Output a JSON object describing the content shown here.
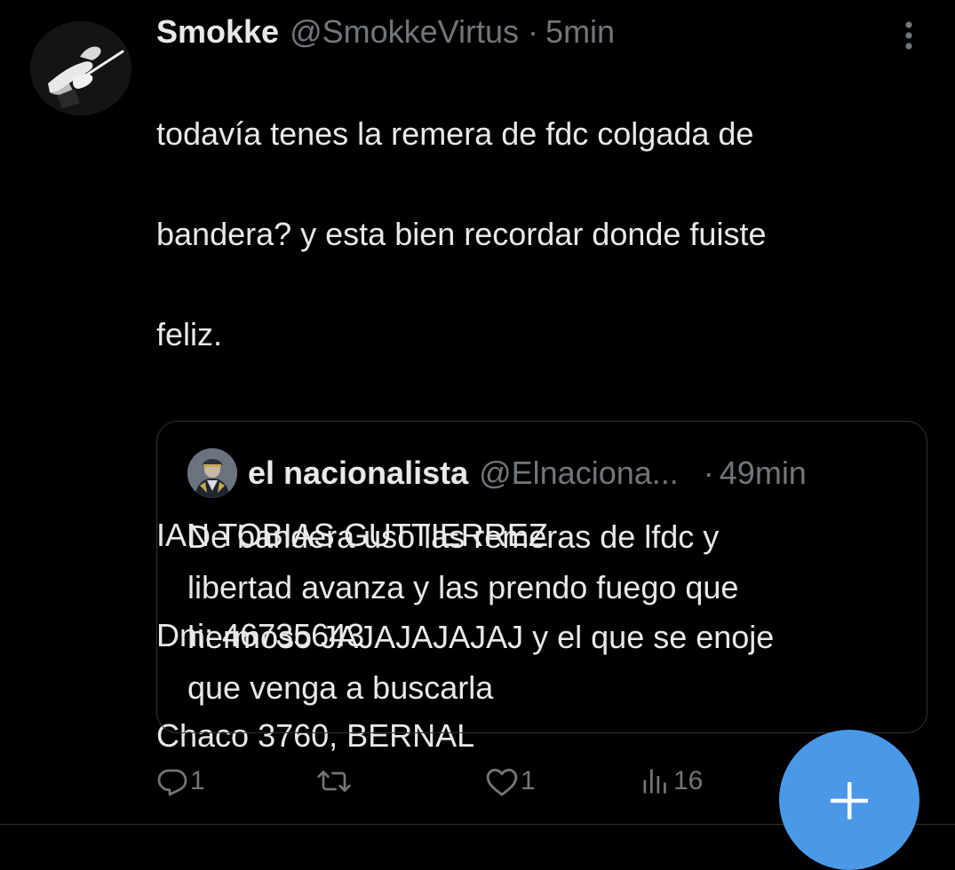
{
  "tweet": {
    "display_name": "Smokke",
    "handle": "@SmokkeVirtus",
    "separator": "·",
    "time": "5min",
    "avatar_icon": "conductor-hands-avatar",
    "text_lines": [
      "todavía tenes la remera de fdc colgada de",
      "bandera? y esta bien recordar donde fuiste",
      "feliz.",
      "",
      "IAN TOBIAS GUTTIERREZ",
      "Dni: 46735643",
      "Chaco 3760, BERNAL"
    ]
  },
  "quoted_tweet": {
    "display_name": "el nacionalista",
    "handle": "@Elnaciona...",
    "separator": "·",
    "time": "49min",
    "avatar_icon": "uniformed-man-avatar",
    "text_lines": [
      "De bandera uso las remeras de lfdc y",
      "libertad avanza y las prendo fuego que",
      "hermoso JAJAJAJAJAJ y el que se enoje",
      "que venga a buscarla"
    ]
  },
  "actions": {
    "reply_count": "1",
    "retweet_count": "",
    "like_count": "1",
    "views_count": "16"
  },
  "colors": {
    "background": "#000000",
    "text": "#e7e9ea",
    "secondary_text": "#71767b",
    "border": "#2f3336",
    "fab": "#4a99e9"
  },
  "icons": {
    "more": "more-vertical-icon",
    "reply": "reply-icon",
    "retweet": "retweet-icon",
    "like": "heart-icon",
    "views": "views-chart-icon",
    "compose": "plus-icon"
  }
}
